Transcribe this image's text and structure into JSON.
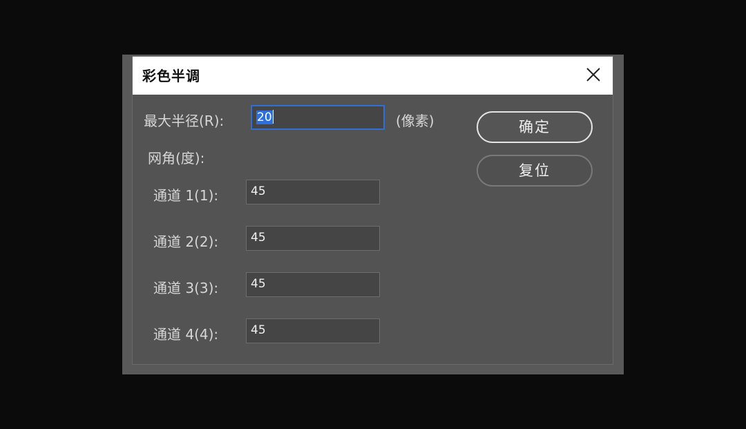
{
  "dialog": {
    "title": "彩色半调"
  },
  "max_radius": {
    "label": "最大半径(R):",
    "value": "20",
    "unit": "(像素)"
  },
  "screen_angles": {
    "label": "网角(度):",
    "channels": [
      {
        "label": "通道 1(1):",
        "value": "45"
      },
      {
        "label": "通道 2(2):",
        "value": "45"
      },
      {
        "label": "通道 3(3):",
        "value": "45"
      },
      {
        "label": "通道 4(4):",
        "value": "45"
      }
    ]
  },
  "buttons": {
    "ok": "确定",
    "reset": "复位"
  },
  "icons": {
    "close": "close-icon"
  }
}
